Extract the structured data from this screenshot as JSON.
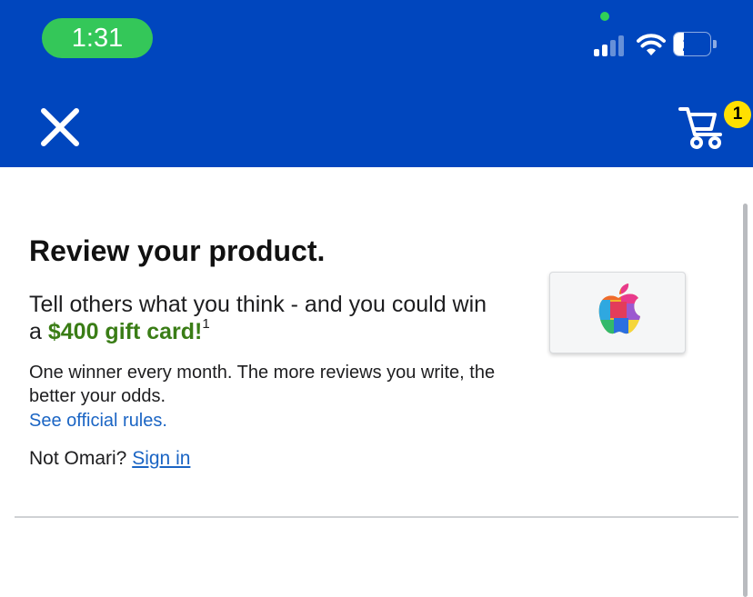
{
  "status_bar": {
    "time": "1:31",
    "battery_level": "27",
    "icons": [
      "cellular-signal-icon",
      "wifi-icon",
      "battery-icon"
    ]
  },
  "nav": {
    "close_icon": "close-icon",
    "cart_icon": "cart-icon",
    "cart_count": "1"
  },
  "review": {
    "title": "Review your product.",
    "promo_prefix": "Tell others what you think - and you could win a ",
    "promo_amount": "$400 gift card!",
    "promo_footnote": "1",
    "odds_text": "One winner every month. The more reviews you write, the better your odds.",
    "rules_link": "See official rules.",
    "not_user_text": "Not Omari?",
    "sign_in_link": "Sign in"
  },
  "product": {
    "image_icon": "apple-logo-icon"
  },
  "colors": {
    "header_blue": "#0046be",
    "time_pill_green": "#34c759",
    "promo_green": "#3a7d16",
    "link_blue": "#1b65c4",
    "badge_yellow": "#ffe000"
  }
}
